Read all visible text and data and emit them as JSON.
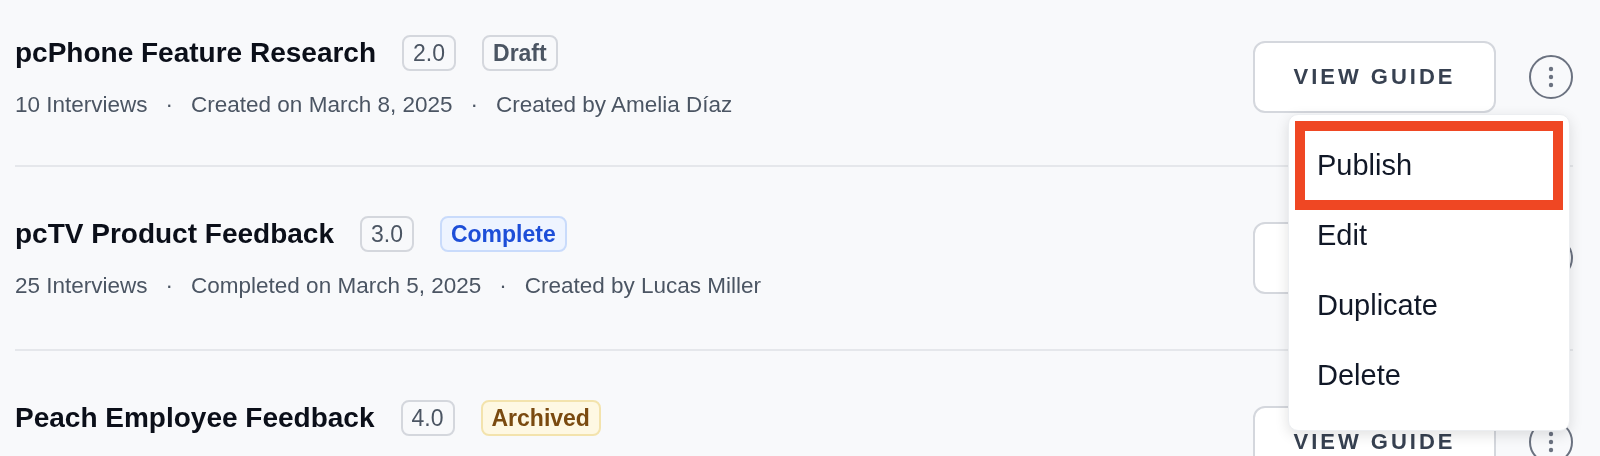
{
  "separator": "·",
  "guides": [
    {
      "title": "pcPhone Feature Research",
      "version": "2.0",
      "status": {
        "label": "Draft",
        "kind": "draft"
      },
      "meta": [
        "10 Interviews",
        "Created on March 8, 2025",
        "Created by Amelia Díaz"
      ],
      "button": "VIEW GUIDE",
      "menu": [
        {
          "label": "Publish",
          "highlighted": true
        },
        {
          "label": "Edit",
          "highlighted": false
        },
        {
          "label": "Duplicate",
          "highlighted": false
        },
        {
          "label": "Delete",
          "highlighted": false
        }
      ]
    },
    {
      "title": "pcTV Product Feedback",
      "version": "3.0",
      "status": {
        "label": "Complete",
        "kind": "complete"
      },
      "meta": [
        "25 Interviews",
        "Completed on March 5, 2025",
        "Created by Lucas Miller"
      ]
    },
    {
      "title": "Peach Employee Feedback",
      "version": "4.0",
      "status": {
        "label": "Archived",
        "kind": "archived"
      },
      "button": "VIEW GUIDE"
    }
  ]
}
